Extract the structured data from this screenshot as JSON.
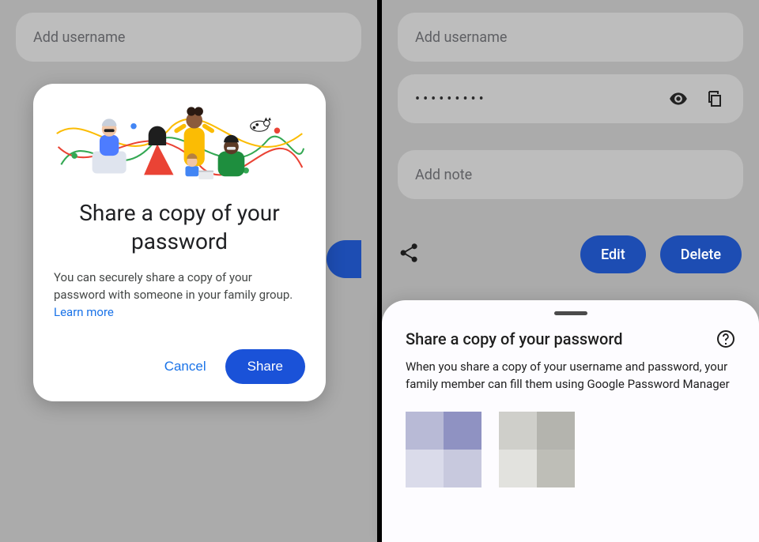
{
  "left": {
    "fields": {
      "username_placeholder": "Add username"
    },
    "dialog": {
      "title": "Share a copy of your password",
      "body": "You can securely share a copy of your password with someone in your family group. ",
      "learn_more": "Learn more",
      "cancel": "Cancel",
      "share": "Share"
    }
  },
  "right": {
    "fields": {
      "username_placeholder": "Add username",
      "password_value": "•••••••••",
      "note_placeholder": "Add note"
    },
    "actions": {
      "edit": "Edit",
      "delete": "Delete"
    },
    "sheet": {
      "title": "Share a copy of your password",
      "body": "When you share a copy of your username and password, your family member can fill them using Google Password Manager"
    }
  }
}
